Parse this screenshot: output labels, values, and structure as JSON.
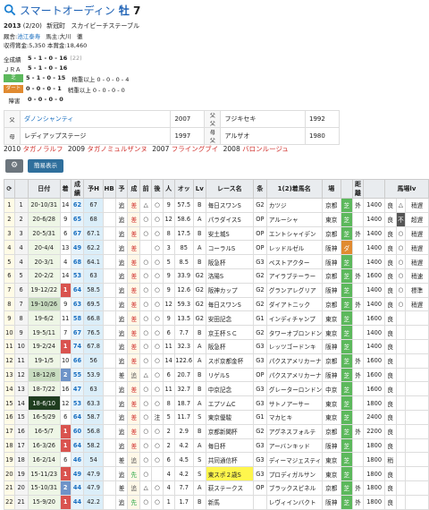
{
  "horse": {
    "name": "スマートオーディン",
    "sex": "牡",
    "age": "7",
    "icon": "search-icon"
  },
  "info": {
    "year": "2013",
    "birth": "(2/20)",
    "place": "新冠町",
    "farm": "スカイビーチステーブル",
    "trainer_label": "厩舎:",
    "trainer": "池江泰寿",
    "owner_label": "馬主:",
    "owner": "大川　徹",
    "prize": "収得賞金:5,350  本賞金:18,460"
  },
  "records": [
    {
      "label": "全成績",
      "vals": "5 - 1 - 0 - 16",
      "extra": "(22)"
    },
    {
      "label": "ＪＲＡ",
      "vals": "5 - 1 - 0 - 16",
      "extra": ""
    },
    {
      "label": "芝",
      "vals": "5 - 1 - 0 - 15",
      "extra": "稍重以上 0 - 0 - 0 - 4"
    },
    {
      "label": "ダート",
      "vals": "0 - 0 - 0 - 1",
      "extra": "稍重以上 0 - 0 - 0 - 0"
    },
    {
      "label": "障害",
      "vals": "0 - 0 - 0 - 0",
      "extra": ""
    }
  ],
  "pedigree": [
    {
      "k": "父",
      "name": "ダノンシャンティ",
      "year": "2007",
      "k2": "父父",
      "name2": "フジキセキ",
      "year2": "1992"
    },
    {
      "k": "母",
      "name": "レディアップステージ",
      "year": "1997",
      "k2": "母父",
      "name2": "アルザオ",
      "year2": "1980"
    }
  ],
  "siblings": [
    {
      "year": "2010",
      "name": "タガノラルフ"
    },
    {
      "year": "2009",
      "name": "タガノミュルザンヌ"
    },
    {
      "year": "2007",
      "name": "フライングブイ"
    },
    {
      "year": "2008",
      "name": "バロンルージュ"
    }
  ],
  "buttons": {
    "settings_icon": "gear-icon",
    "simple": "簡易表示"
  },
  "table": {
    "headers": [
      "⟳",
      "",
      "日付",
      "着",
      "成績",
      "予H",
      "HB",
      "予",
      "成",
      "前",
      "後",
      "人",
      "オッ",
      "Lv",
      "レース名",
      "条",
      "1(2)着馬名",
      "場",
      "",
      "距離",
      "",
      "馬場lv"
    ],
    "rows": [
      [
        "1",
        "1",
        "20-10/31",
        "14",
        "62",
        "67",
        "",
        "追",
        "差",
        "△",
        "○",
        "9",
        "57.5",
        "B",
        "毎日スワンS",
        "G2",
        "カツジ",
        "京都",
        "芝",
        "外",
        "1400",
        "良",
        "△",
        "稍遅"
      ],
      [
        "2",
        "2",
        "20-6/28",
        "9",
        "65",
        "68",
        "",
        "追",
        "差",
        "○",
        "○",
        "12",
        "58.6",
        "A",
        "パラダイスS",
        "OP",
        "アルーシャ",
        "東京",
        "芝",
        "",
        "1400",
        "良",
        "不",
        "超遅"
      ],
      [
        "3",
        "3",
        "20-5/31",
        "6",
        "67",
        "67.1",
        "",
        "追",
        "差",
        "○",
        "○",
        "8",
        "17.5",
        "B",
        "安土城S",
        "OP",
        "エントシャイデン",
        "京都",
        "芝",
        "外",
        "1400",
        "良",
        "○",
        "稍遅"
      ],
      [
        "4",
        "4",
        "20-4/4",
        "13",
        "49",
        "62.2",
        "",
        "追",
        "差",
        "",
        "○",
        "3",
        "85",
        "A",
        "コーラルS",
        "OP",
        "レッドルゼル",
        "阪神",
        "ダ",
        "",
        "1400",
        "良",
        "○",
        "稍遅"
      ],
      [
        "5",
        "4",
        "20-3/1",
        "4",
        "68",
        "64.1",
        "",
        "追",
        "差",
        "○",
        "○",
        "5",
        "8.5",
        "B",
        "阪急杯",
        "G3",
        "ベストアクター",
        "阪神",
        "芝",
        "",
        "1400",
        "良",
        "○",
        "稍遅"
      ],
      [
        "6",
        "5",
        "20-2/2",
        "14",
        "53",
        "63",
        "",
        "追",
        "差",
        "○",
        "○",
        "9",
        "33.9",
        "G2",
        "洛陽S",
        "G2",
        "アイラブテーラー",
        "京都",
        "芝",
        "外",
        "1600",
        "良",
        "○",
        "稍速"
      ],
      [
        "7",
        "6",
        "19-12/22",
        "1",
        "64",
        "58.5",
        "",
        "追",
        "差",
        "○",
        "○",
        "9",
        "12.6",
        "G2",
        "阪神カップ",
        "G2",
        "グランアレグリア",
        "阪神",
        "芝",
        "",
        "1400",
        "良",
        "○",
        "標準"
      ],
      [
        "8",
        "7",
        "19-10/26",
        "9",
        "63",
        "69.5",
        "",
        "追",
        "差",
        "○",
        "○",
        "12",
        "59.3",
        "G2",
        "毎日スワンS",
        "G2",
        "ダイアトニック",
        "京都",
        "芝",
        "外",
        "1400",
        "良",
        "○",
        "稍遅"
      ],
      [
        "9",
        "8",
        "19-6/2",
        "11",
        "58",
        "66.8",
        "",
        "追",
        "差",
        "○",
        "○",
        "9",
        "13.5",
        "G2",
        "安田記念",
        "G1",
        "インディチャンプ",
        "東京",
        "芝",
        "",
        "1600",
        "良",
        "",
        ""
      ],
      [
        "10",
        "9",
        "19-5/11",
        "7",
        "67",
        "76.5",
        "",
        "追",
        "差",
        "○",
        "○",
        "6",
        "7.7",
        "B",
        "京王杯ＳＣ",
        "G2",
        "タワーオブロンドン",
        "東京",
        "芝",
        "",
        "1400",
        "良",
        "",
        ""
      ],
      [
        "11",
        "10",
        "19-2/24",
        "1",
        "74",
        "67.8",
        "",
        "追",
        "差",
        "○",
        "○",
        "11",
        "32.3",
        "A",
        "阪急杯",
        "G3",
        "レッツゴードンキ",
        "阪神",
        "芝",
        "",
        "1400",
        "良",
        "",
        ""
      ],
      [
        "12",
        "11",
        "19-1/5",
        "10",
        "66",
        "56",
        "",
        "追",
        "差",
        "○",
        "○",
        "14",
        "122.6",
        "A",
        "スポ京都金杯",
        "G3",
        "パクスアメリカーナ",
        "京都",
        "芝",
        "外",
        "1600",
        "良",
        "",
        ""
      ],
      [
        "13",
        "12",
        "18-12/8",
        "2",
        "55",
        "53.9",
        "",
        "差",
        "追",
        "△",
        "○",
        "6",
        "20.7",
        "B",
        "リゲルS",
        "OP",
        "パクスアメリカーナ",
        "阪神",
        "芝",
        "外",
        "1600",
        "良",
        "",
        ""
      ],
      [
        "14",
        "13",
        "18-7/22",
        "16",
        "47",
        "63",
        "",
        "追",
        "差",
        "○",
        "○",
        "11",
        "32.7",
        "B",
        "中京記念",
        "G3",
        "グレーターロンドン",
        "中京",
        "芝",
        "",
        "1600",
        "良",
        "",
        ""
      ],
      [
        "15",
        "14",
        "18-6/10",
        "12",
        "53",
        "63.3",
        "",
        "追",
        "差",
        "○",
        "○",
        "8",
        "18.7",
        "A",
        "エプソムC",
        "G3",
        "サトノアーサー",
        "東京",
        "芝",
        "",
        "1800",
        "良",
        "",
        ""
      ],
      [
        "16",
        "15",
        "16-5/29",
        "6",
        "64",
        "58.7",
        "",
        "追",
        "差",
        "○",
        "注",
        "5",
        "11.7",
        "S",
        "東京優駿",
        "G1",
        "マカヒキ",
        "東京",
        "芝",
        "",
        "2400",
        "良",
        "",
        ""
      ],
      [
        "17",
        "16",
        "16-5/7",
        "1",
        "60",
        "56.8",
        "",
        "追",
        "差",
        "○",
        "○",
        "2",
        "2.9",
        "B",
        "京都新聞杯",
        "G2",
        "アグネスフォルテ",
        "京都",
        "芝",
        "外",
        "2200",
        "良",
        "",
        ""
      ],
      [
        "18",
        "17",
        "16-3/26",
        "1",
        "64",
        "58.2",
        "",
        "追",
        "差",
        "○",
        "○",
        "2",
        "4.2",
        "A",
        "毎日杯",
        "G3",
        "アーバンキッド",
        "阪神",
        "芝",
        "",
        "1800",
        "良",
        "",
        ""
      ],
      [
        "19",
        "18",
        "16-2/14",
        "6",
        "46",
        "54",
        "",
        "差",
        "追",
        "○",
        "○",
        "6",
        "4.5",
        "S",
        "共同通信杯",
        "G3",
        "ディーマジェスティ",
        "東京",
        "芝",
        "",
        "1800",
        "稍",
        "",
        ""
      ],
      [
        "20",
        "19",
        "15-11/23",
        "1",
        "49",
        "47.9",
        "",
        "追",
        "先",
        "○",
        "",
        "4",
        "4.2",
        "S",
        "東スポ２歳S",
        "G3",
        "プロディガルサン",
        "東京",
        "芝",
        "",
        "1800",
        "良",
        "",
        ""
      ],
      [
        "21",
        "20",
        "15-10/31",
        "2",
        "44",
        "47.9",
        "",
        "差",
        "追",
        "△",
        "○",
        "4",
        "7.7",
        "A",
        "萩ステークス",
        "OP",
        "ブラックスピネル",
        "京都",
        "芝",
        "外",
        "1800",
        "良",
        "",
        ""
      ],
      [
        "22",
        "21",
        "15-9/20",
        "1",
        "44",
        "42.2",
        "",
        "追",
        "先",
        "○",
        "○",
        "1",
        "1.7",
        "B",
        "新馬",
        "",
        "レヴィインバクト",
        "阪神",
        "芝",
        "外",
        "1800",
        "良",
        "",
        ""
      ]
    ]
  }
}
